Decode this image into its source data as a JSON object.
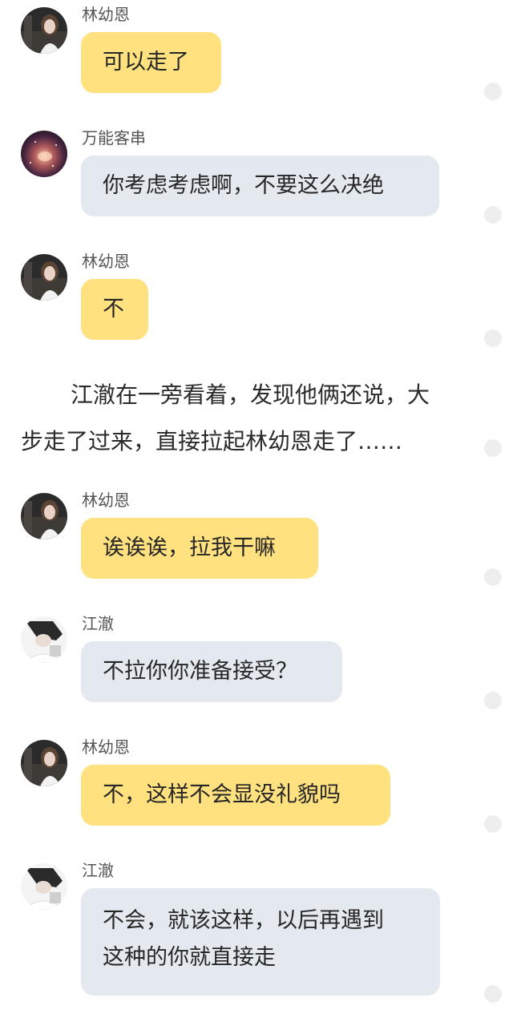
{
  "names": {
    "lin": "林幼恩",
    "wanneng": "万能客串",
    "jiang": "江澈"
  },
  "messages": [
    {
      "text": "可以走了"
    },
    {
      "text": "你考虑考虑啊，不要这么决绝"
    },
    {
      "text": "不"
    },
    {
      "text": "诶诶诶，拉我干嘛"
    },
    {
      "text": "不拉你你准备接受？"
    },
    {
      "text": "不，这样不会显没礼貌吗"
    },
    {
      "line1": "不会，就该这样，以后再遇到",
      "line2": "这种的你就直接走"
    }
  ],
  "narration": {
    "line1": "江澈在一旁看着，发现他俩还说，大",
    "line2": "步走了过来，直接拉起林幼恩走了……"
  },
  "colors": {
    "bubble_yellow": "#ffe180",
    "bubble_gray": "#e4e8ef",
    "status_dot": "#eeeeee"
  },
  "icons": {
    "avatar_lin": "girl-photo-avatar",
    "avatar_wanneng": "galaxy-avatar",
    "avatar_jiang": "boy-photo-avatar",
    "status": "circle-status-dot"
  }
}
